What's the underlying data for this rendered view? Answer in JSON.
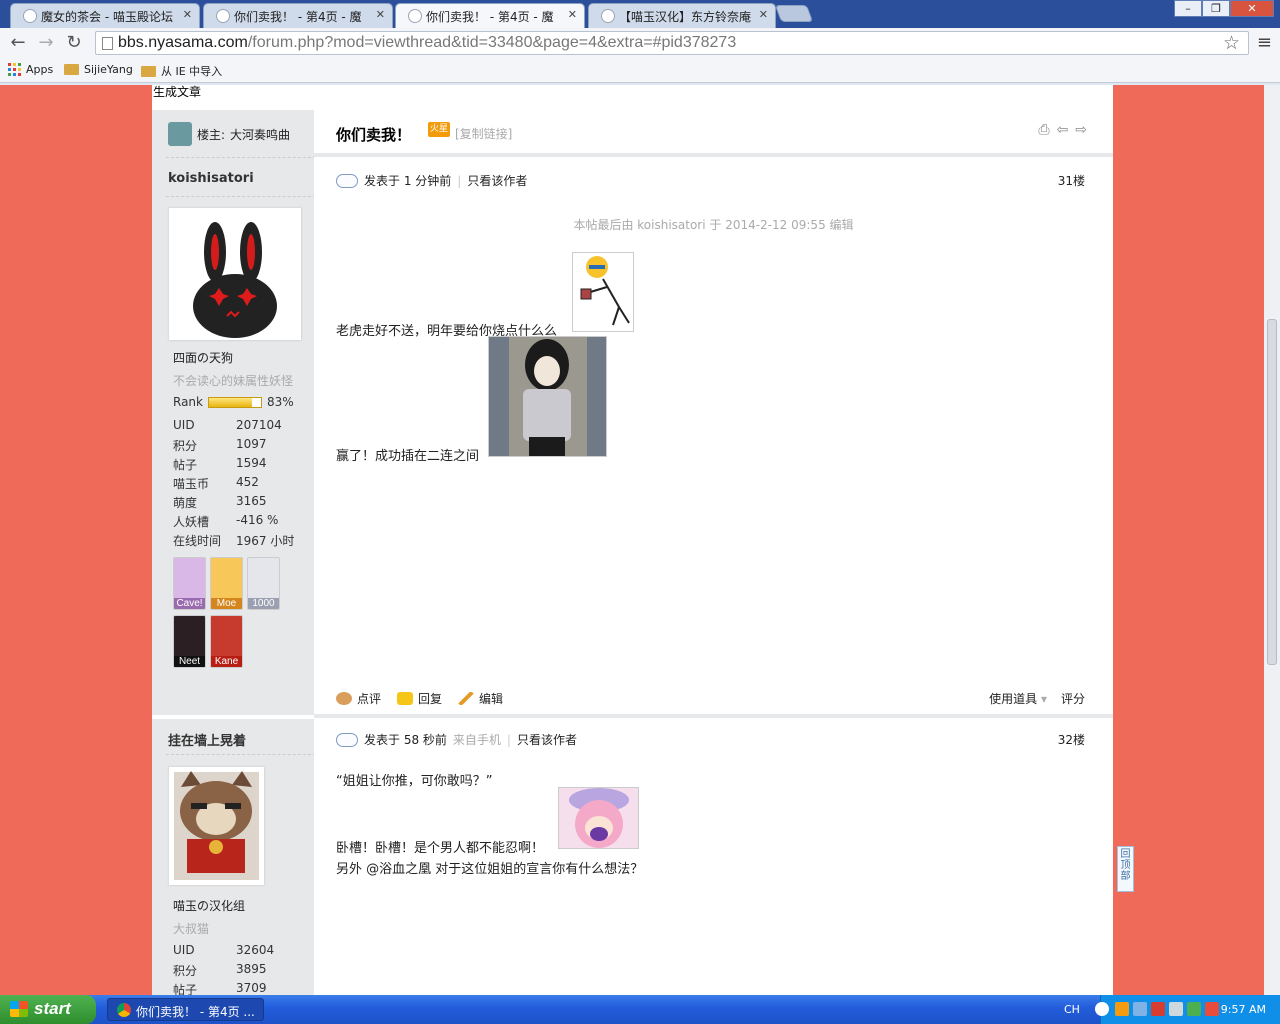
{
  "browser": {
    "tabs": [
      {
        "title": "魔女的茶会 - 喵玉殿论坛"
      },
      {
        "title": "你们卖我！ - 第4页 - 魔"
      },
      {
        "title": "你们卖我！ - 第4页 - 魔"
      },
      {
        "title": "【喵玉汉化】东方铃奈庵"
      }
    ],
    "window_buttons": {
      "minimize": "–",
      "restore": "❐",
      "close": "✕"
    },
    "url_host": "bbs.nyasama.com",
    "url_path": "/forum.php?mod=viewthread&tid=33480&page=4&extra=#pid378273",
    "bookmarks": [
      {
        "label": "Apps",
        "icon": "apps-grid-icon"
      },
      {
        "label": "SijieYang",
        "icon": "folder-icon"
      },
      {
        "label": "从 IE 中导入",
        "icon": "folder-icon"
      }
    ]
  },
  "page": {
    "top_text": "生成文章",
    "thread_title": "你们卖我！",
    "hot_badge": "火星",
    "copy_link": "[复制链接]",
    "op": {
      "prefix": "楼主:",
      "name": "大河奏鸣曲"
    },
    "posts": [
      {
        "author": "koishisatori",
        "group": "四面の天狗",
        "custom_title": "不会读心的妹属性妖怪",
        "rank_label": "Rank",
        "rank_pct": 83,
        "rank_text": "83%",
        "stats": [
          {
            "k": "UID",
            "v": "207104"
          },
          {
            "k": "积分",
            "v": "1097"
          },
          {
            "k": "帖子",
            "v": "1594"
          },
          {
            "k": "喵玉币",
            "v": "452"
          },
          {
            "k": "萌度",
            "v": "3165"
          },
          {
            "k": "人妖槽",
            "v": "-416 %"
          },
          {
            "k": "在线时间",
            "v": "1967 小时"
          }
        ],
        "medals": [
          "Cave!",
          "Moe",
          "1000",
          "Neet",
          "Kane"
        ],
        "posted": "发表于 1 分钟前",
        "author_only": "只看该作者",
        "floor": "31楼",
        "edit_note": "本帖最后由 koishisatori 于 2014-2-12 09:55 编辑",
        "lines": [
          "老虎走好不送，明年要给你烧点什么么",
          "赢了！成功插在二连之间"
        ],
        "actions": [
          "点评",
          "回复",
          "编辑"
        ],
        "right_actions": [
          "使用道具",
          "评分"
        ]
      },
      {
        "author": "挂在墙上晃着",
        "group": "喵玉の汉化组",
        "custom_title": "大叔猫",
        "stats": [
          {
            "k": "UID",
            "v": "32604"
          },
          {
            "k": "积分",
            "v": "3895"
          },
          {
            "k": "帖子",
            "v": "3709"
          }
        ],
        "posted": "发表于 58 秒前",
        "from_mobile": "来自手机",
        "author_only": "只看该作者",
        "floor": "32楼",
        "lines": [
          "“姐姐让你推，可你敢吗？”",
          "卧槽！卧槽！是个男人都不能忍啊！",
          "另外  @浴血之凰    对于这位姐姐的宣言你有什么想法？"
        ]
      }
    ],
    "back_to_top": "回顶部"
  },
  "taskbar": {
    "start": "start",
    "window": "你们卖我！ - 第4页 ...",
    "lang": "CH",
    "clock": "9:57 AM"
  }
}
